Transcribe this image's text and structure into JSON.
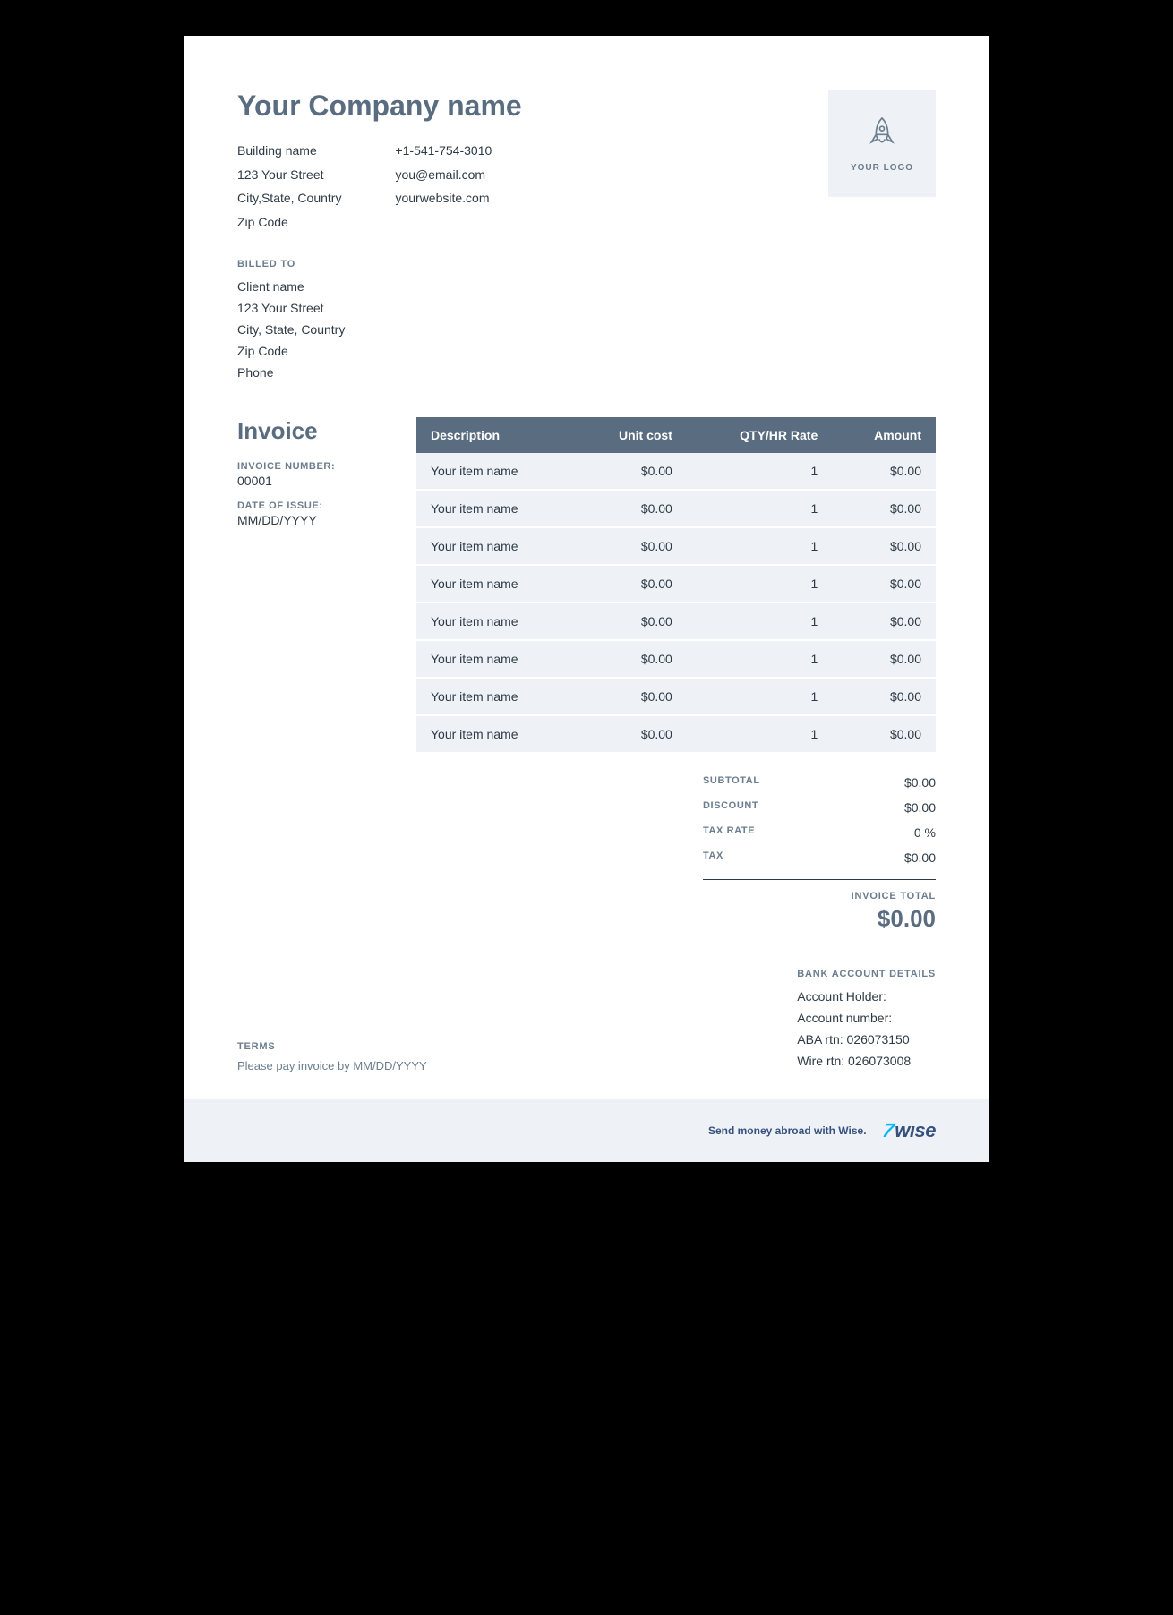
{
  "company": {
    "name": "Your Company name",
    "address": {
      "building": "Building name",
      "street": "123 Your Street",
      "city_state_country": "City,State, Country",
      "zip": "Zip Code"
    },
    "contact": {
      "phone": "+1-541-754-3010",
      "email": "you@email.com",
      "website": "yourwebsite.com"
    }
  },
  "logo": {
    "placeholder_text": "YOUR LOGO"
  },
  "labels": {
    "billed_to": "BILLED TO",
    "invoice": "Invoice",
    "invoice_number": "INVOICE NUMBER:",
    "date_of_issue": "DATE OF ISSUE:",
    "subtotal": "SUBTOTAL",
    "discount": "DISCOUNT",
    "tax_rate": "TAX RATE",
    "tax": "TAX",
    "invoice_total": "INVOICE TOTAL",
    "bank_details": "BANK ACCOUNT DETAILS",
    "terms": "TERMS"
  },
  "billed_to": {
    "name": "Client name",
    "street": "123 Your Street",
    "city_state_country": "City, State, Country",
    "zip": "Zip Code",
    "phone": "Phone"
  },
  "invoice": {
    "number": "00001",
    "date_of_issue": "MM/DD/YYYY"
  },
  "table": {
    "headers": {
      "description": "Description",
      "unit_cost": "Unit cost",
      "qty": "QTY/HR Rate",
      "amount": "Amount"
    },
    "items": [
      {
        "description": "Your item name",
        "unit_cost": "$0.00",
        "qty": "1",
        "amount": "$0.00"
      },
      {
        "description": "Your item name",
        "unit_cost": "$0.00",
        "qty": "1",
        "amount": "$0.00"
      },
      {
        "description": "Your item name",
        "unit_cost": "$0.00",
        "qty": "1",
        "amount": "$0.00"
      },
      {
        "description": "Your item name",
        "unit_cost": "$0.00",
        "qty": "1",
        "amount": "$0.00"
      },
      {
        "description": "Your item name",
        "unit_cost": "$0.00",
        "qty": "1",
        "amount": "$0.00"
      },
      {
        "description": "Your item name",
        "unit_cost": "$0.00",
        "qty": "1",
        "amount": "$0.00"
      },
      {
        "description": "Your item name",
        "unit_cost": "$0.00",
        "qty": "1",
        "amount": "$0.00"
      },
      {
        "description": "Your item name",
        "unit_cost": "$0.00",
        "qty": "1",
        "amount": "$0.00"
      }
    ]
  },
  "totals": {
    "subtotal": "$0.00",
    "discount": "$0.00",
    "tax_rate": "0 %",
    "tax": "$0.00",
    "invoice_total": "$0.00"
  },
  "bank": {
    "holder_label": "Account Holder:",
    "number_label": "Account number:",
    "aba": "ABA rtn: 026073150",
    "wire": "Wire rtn: 026073008"
  },
  "terms": {
    "text": "Please pay invoice by MM/DD/YYYY"
  },
  "footer": {
    "text": "Send money abroad with Wise.",
    "brand": "wıse"
  }
}
